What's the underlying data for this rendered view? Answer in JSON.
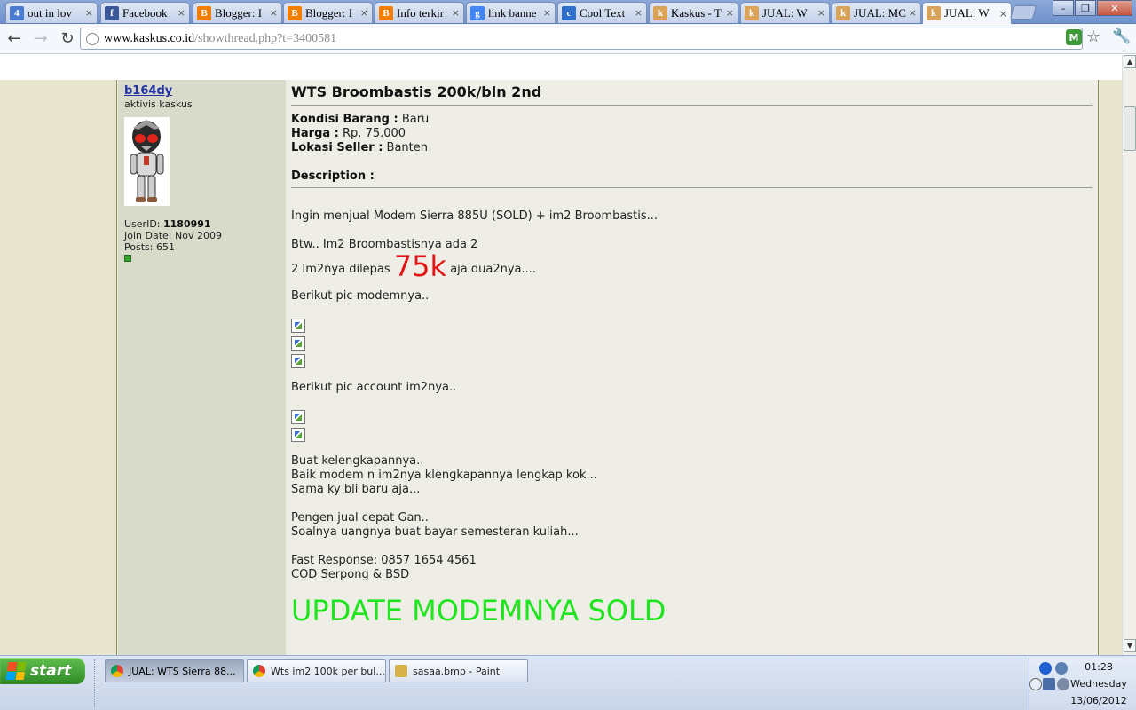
{
  "tabs": [
    {
      "title": "out in lov",
      "icon": "four-icon",
      "color": "#4a7bd0"
    },
    {
      "title": "Facebook",
      "icon": "facebook-icon",
      "color": "#3b5998"
    },
    {
      "title": "Blogger: I",
      "icon": "blogger-icon",
      "color": "#f57d00"
    },
    {
      "title": "Blogger: I",
      "icon": "blogger-icon",
      "color": "#f57d00"
    },
    {
      "title": "Info terkir",
      "icon": "blogger-icon",
      "color": "#f57d00"
    },
    {
      "title": "link banne",
      "icon": "google-icon",
      "color": "#4285f4"
    },
    {
      "title": "Cool Text",
      "icon": "cooltext-icon",
      "color": "#2d6fcb"
    },
    {
      "title": "Kaskus - T",
      "icon": "kaskus-icon",
      "color": "#d9a45a"
    },
    {
      "title": "JUAL: W",
      "icon": "kaskus-icon",
      "color": "#d9a45a"
    },
    {
      "title": "JUAL: MC",
      "icon": "kaskus-icon",
      "color": "#d9a45a"
    },
    {
      "title": "JUAL: W",
      "icon": "kaskus-icon",
      "color": "#d9a45a"
    }
  ],
  "tab_close": "×",
  "address": {
    "host": "www.kaskus.co.id",
    "path": "/showthread.php?t=3400581"
  },
  "user": {
    "name": "b164dy",
    "title": "aktivis kaskus",
    "userid_label": "UserID:",
    "userid": "1180991",
    "join_label": "Join Date:",
    "join": "Nov 2009",
    "posts_label": "Posts:",
    "posts": "651"
  },
  "post": {
    "title": "WTS Broombastis 200k/bln 2nd",
    "kondisi_label": "Kondisi Barang :",
    "kondisi": "Baru",
    "harga_label": "Harga :",
    "harga": "Rp. 75.000",
    "lokasi_label": "Lokasi Seller :",
    "lokasi": "Banten",
    "desc_label": "Description :",
    "line1": "Ingin menjual Modem Sierra 885U (SOLD) + im2 Broombastis...",
    "line2": "Btw.. Im2 Broombastisnya ada 2",
    "line3_pre": "2 Im2nya dilepas",
    "line3_price": "75k",
    "line3_post": "aja dua2nya....",
    "line4": "Berikut pic modemnya..",
    "line5": "Berikut pic account im2nya..",
    "line6": "Buat kelengkapannya..",
    "line7": "Baik modem n im2nya klengkapannya lengkap kok...",
    "line8": "Sama ky bli baru aja...",
    "line9": "Pengen jual cepat Gan..",
    "line10": "Soalnya uangnya buat bayar semesteran kuliah...",
    "line11": "Fast Response: 0857 1654 4561",
    "line12": "COD Serpong & BSD",
    "update": "UPDATE MODEMNYA SOLD"
  },
  "taskbar": {
    "start": "start",
    "items": [
      {
        "label": "JUAL: WTS Sierra 88...",
        "active": true
      },
      {
        "label": "Wts im2 100k per bul...",
        "active": false
      },
      {
        "label": "sasaa.bmp - Paint",
        "active": false
      }
    ],
    "time": "01:28",
    "day": "Wednesday",
    "date": "13/06/2012"
  }
}
